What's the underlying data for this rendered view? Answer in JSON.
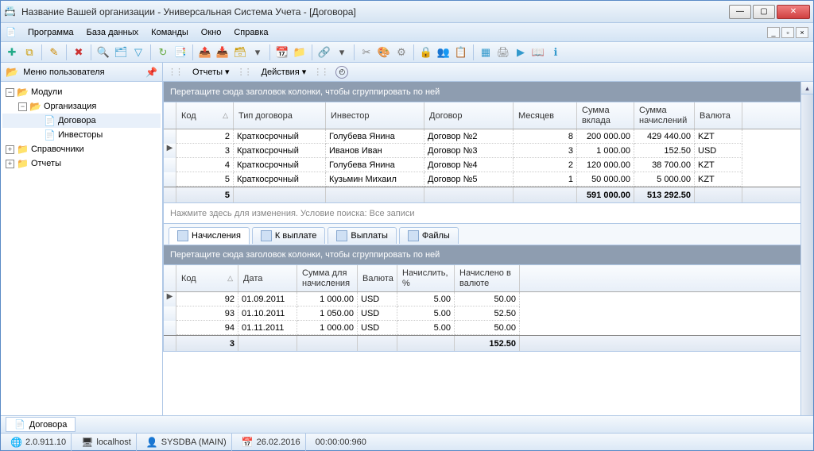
{
  "window": {
    "title": "Название Вашей организации - Универсальная Система Учета - [Договора]"
  },
  "menu": {
    "program": "Программа",
    "db": "База данных",
    "commands": "Команды",
    "window": "Окно",
    "help": "Справка"
  },
  "sidebar": {
    "header": "Меню пользователя",
    "nodes": {
      "modules": "Модули",
      "organization": "Организация",
      "contracts": "Договора",
      "investors": "Инвесторы",
      "refs": "Справочники",
      "reports": "Отчеты"
    }
  },
  "actionbar": {
    "reports": "Отчеты",
    "actions": "Действия"
  },
  "groupbar_text": "Перетащите сюда заголовок колонки, чтобы сгруппировать по ней",
  "top_grid": {
    "headers": {
      "code": "Код",
      "type": "Тип договора",
      "investor": "Инвестор",
      "contract": "Договор",
      "months": "Месяцев",
      "deposit": "Сумма вклада",
      "accrual": "Сумма начислений",
      "currency": "Валюта"
    },
    "rows": [
      {
        "code": "2",
        "type": "Краткосрочный",
        "investor": "Голубева Янина",
        "contract": "Договор №2",
        "months": "8",
        "deposit": "200 000.00",
        "accrual": "429 440.00",
        "currency": "KZT"
      },
      {
        "code": "3",
        "type": "Краткосрочный",
        "investor": "Иванов Иван",
        "contract": "Договор №3",
        "months": "3",
        "deposit": "1 000.00",
        "accrual": "152.50",
        "currency": "USD"
      },
      {
        "code": "4",
        "type": "Краткосрочный",
        "investor": "Голубева Янина",
        "contract": "Договор №4",
        "months": "2",
        "deposit": "120 000.00",
        "accrual": "38 700.00",
        "currency": "KZT"
      },
      {
        "code": "5",
        "type": "Краткосрочный",
        "investor": "Кузьмин Михаил",
        "contract": "Договор №5",
        "months": "1",
        "deposit": "50 000.00",
        "accrual": "5 000.00",
        "currency": "KZT"
      }
    ],
    "footer": {
      "count": "5",
      "deposit": "591 000.00",
      "accrual": "513 292.50"
    }
  },
  "search_hint": "Нажмите здесь для изменения. Условие поиска: Все записи",
  "detail_tabs": {
    "accruals": "Начисления",
    "to_pay": "К выплате",
    "payments": "Выплаты",
    "files": "Файлы"
  },
  "bottom_grid": {
    "headers": {
      "code": "Код",
      "date": "Дата",
      "sum": "Сумма для начисления",
      "currency": "Валюта",
      "pct": "Начислить, %",
      "result": "Начислено в валюте"
    },
    "rows": [
      {
        "code": "92",
        "date": "01.09.2011",
        "sum": "1 000.00",
        "currency": "USD",
        "pct": "5.00",
        "result": "50.00"
      },
      {
        "code": "93",
        "date": "01.10.2011",
        "sum": "1 050.00",
        "currency": "USD",
        "pct": "5.00",
        "result": "52.50"
      },
      {
        "code": "94",
        "date": "01.11.2011",
        "sum": "1 000.00",
        "currency": "USD",
        "pct": "5.00",
        "result": "50.00"
      }
    ],
    "footer": {
      "count": "3",
      "result": "152.50"
    }
  },
  "doc_tab": "Договора",
  "status": {
    "version": "2.0.911.10",
    "host": "localhost",
    "user": "SYSDBA (MAIN)",
    "date": "26.02.2016",
    "time": "00:00:00:960"
  }
}
